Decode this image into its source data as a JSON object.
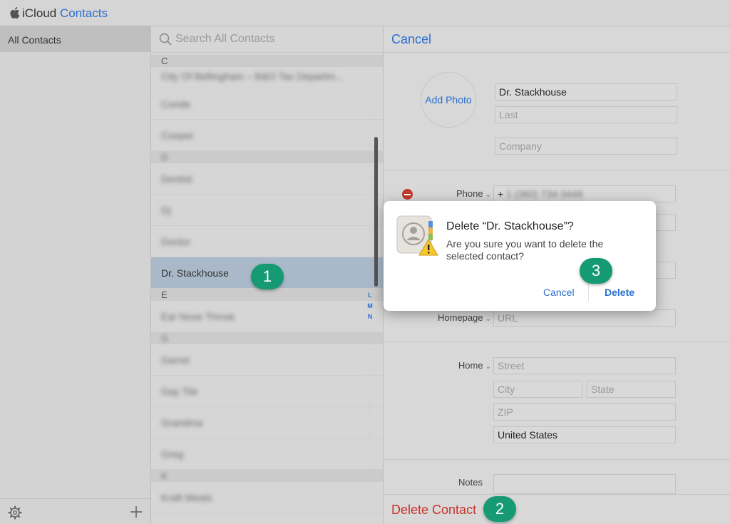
{
  "app": {
    "brand": "iCloud",
    "title": "Contacts",
    "accent_color": "#2a6fd1"
  },
  "sidebar": {
    "groups": [
      {
        "label": "All Contacts"
      }
    ]
  },
  "search": {
    "placeholder": "Search All Contacts"
  },
  "list": {
    "section_c": "C",
    "row_c1": "City Of Bellingham – B&O Tax Departm...",
    "row_c2": "Conde",
    "row_c3": "Cooper",
    "section_d": "D",
    "row_d1": "Dentist",
    "row_d2": "Dj",
    "row_d3": "Doctor",
    "row_selected": "Dr. Stackhouse",
    "section_e": "E",
    "row_e1": "Ear Nose Throat",
    "section_g": "G",
    "row_g1": "Garret",
    "row_g2": "Gay Tile",
    "row_g3": "Grandma",
    "row_g4": "Greg",
    "section_k": "K",
    "row_k1": "Kraft Meats",
    "index_l": "L",
    "index_m": "M",
    "index_n": "N"
  },
  "detail": {
    "cancel_label": "Cancel",
    "add_photo_label": "Add Photo",
    "first_name": "Dr. Stackhouse",
    "last_placeholder": "Last",
    "company_placeholder": "Company",
    "phone_label": "Phone",
    "phone_prefix": "+",
    "phone_value": "1 (360) 734-3448",
    "homepage_label": "Homepage",
    "url_placeholder": "URL",
    "home_label": "Home",
    "street_placeholder": "Street",
    "city_placeholder": "City",
    "state_placeholder": "State",
    "zip_placeholder": "ZIP",
    "country": "United States",
    "notes_label": "Notes",
    "delete_contact_label": "Delete Contact",
    "delete_color": "#c9322a"
  },
  "dialog": {
    "title": "Delete “Dr. Stackhouse”?",
    "message": "Are you sure you want to delete the selected contact?",
    "cancel_label": "Cancel",
    "delete_label": "Delete",
    "icon": "contacts-warning-icon"
  },
  "badges": {
    "one": "1",
    "two": "2",
    "three": "3",
    "color": "#169a73"
  }
}
